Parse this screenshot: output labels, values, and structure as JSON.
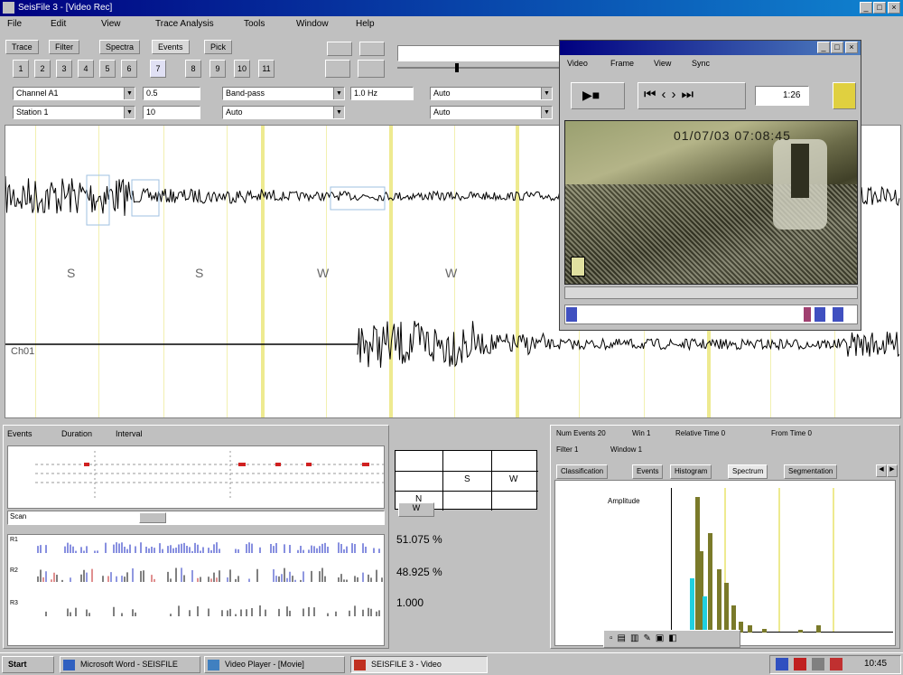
{
  "window": {
    "title": "SeisFile 3 - [Video Rec]"
  },
  "menu": [
    "File",
    "Edit",
    "View",
    "Trace Analysis",
    "Tools",
    "Window",
    "Help"
  ],
  "tabs": [
    "Trace",
    "Filter",
    "Spectra",
    "Events",
    "Pick"
  ],
  "toolbar_buttons": [
    "1",
    "2",
    "3",
    "4",
    "5",
    "6",
    "7",
    "8",
    "9",
    "10",
    "11"
  ],
  "controls": {
    "combo1": "Channel A1",
    "combo2": "Station 1",
    "field1": "0.5",
    "field2": "10",
    "combo3": "Band-pass",
    "combo4": "Auto",
    "field3": "1.0 Hz",
    "combo5": "Auto",
    "combo6": "Auto"
  },
  "main_plot": {
    "labels": [
      "S",
      "S",
      "W",
      "W"
    ],
    "track_label": "Ch01"
  },
  "video_window": {
    "menu": [
      "Video",
      "Frame",
      "View",
      "Sync"
    ],
    "timestamp": "01/07/03  07:08:45",
    "counter": "1:26"
  },
  "left_panel": {
    "tabs": [
      "Events",
      "Duration",
      "Interval"
    ],
    "rows": [
      "R1",
      "R2",
      "R3"
    ],
    "scroll_label": "Scan"
  },
  "middle_panel": {
    "grid_headers": [
      "S",
      "W"
    ],
    "row_labels": [
      "N",
      "W"
    ],
    "readouts": [
      "51.075 %",
      "48.925 %",
      "1.000"
    ]
  },
  "right_panel": {
    "info_line1": [
      "Num Events 20",
      "Win 1",
      "Relative Time 0",
      "From Time 0"
    ],
    "info_line2": [
      "Filter 1",
      "Window 1"
    ],
    "tabs": [
      "Classification",
      "Events",
      "Histogram",
      "Spectrum",
      "Segmentation"
    ],
    "legend_text": "Amplitude"
  },
  "taskbar": {
    "start": "Start",
    "tasks": [
      "Microsoft Word - SEISFILE",
      "Video Player - [Movie]",
      "SEISFILE 3 - Video"
    ],
    "clock": "10:45"
  },
  "colors": {
    "titlebar": "#000080",
    "wave": "#000000",
    "grid": "#eeea90",
    "hist_bar": "#7a7a2a",
    "hist_cyan": "#20d0e0"
  }
}
